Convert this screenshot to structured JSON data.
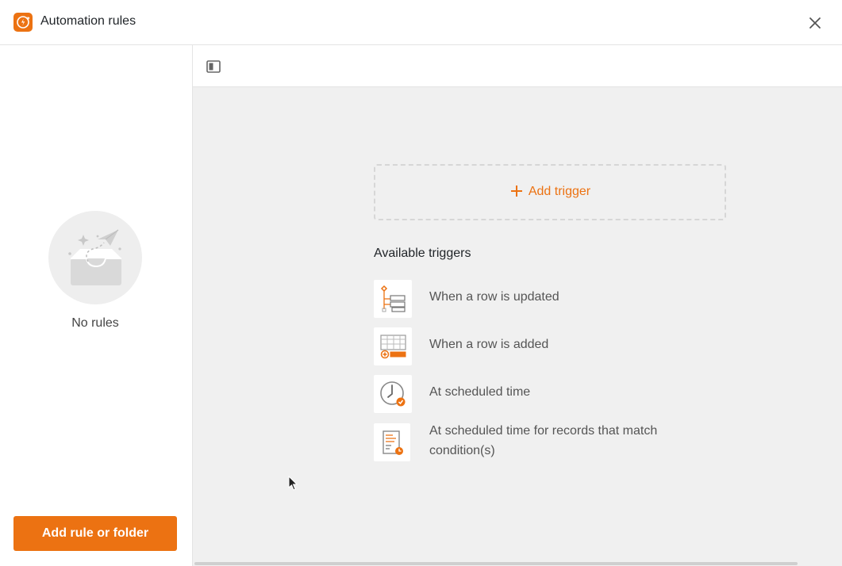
{
  "window": {
    "title": "Automation rules",
    "icons": {
      "app": "automation-app-icon",
      "close": "close-icon"
    }
  },
  "sidebar": {
    "empty_text": "No rules",
    "add_button_label": "Add rule or folder",
    "illustration": "empty-inbox-paper-plane"
  },
  "toolbar": {
    "toggle_icon": "panel-toggle-icon"
  },
  "main": {
    "add_trigger_label": "Add trigger",
    "available_triggers_heading": "Available triggers",
    "triggers": [
      {
        "label": "When a row is updated",
        "icon": "row-updated-icon"
      },
      {
        "label": "When a row is added",
        "icon": "row-added-icon"
      },
      {
        "label": "At scheduled time",
        "icon": "scheduled-time-icon"
      },
      {
        "label": "At scheduled time for records that match condition(s)",
        "icon": "scheduled-records-icon"
      }
    ]
  },
  "colors": {
    "accent": "#ec7212",
    "panel_background": "#f0f0f0",
    "border": "#e4e4e4"
  }
}
